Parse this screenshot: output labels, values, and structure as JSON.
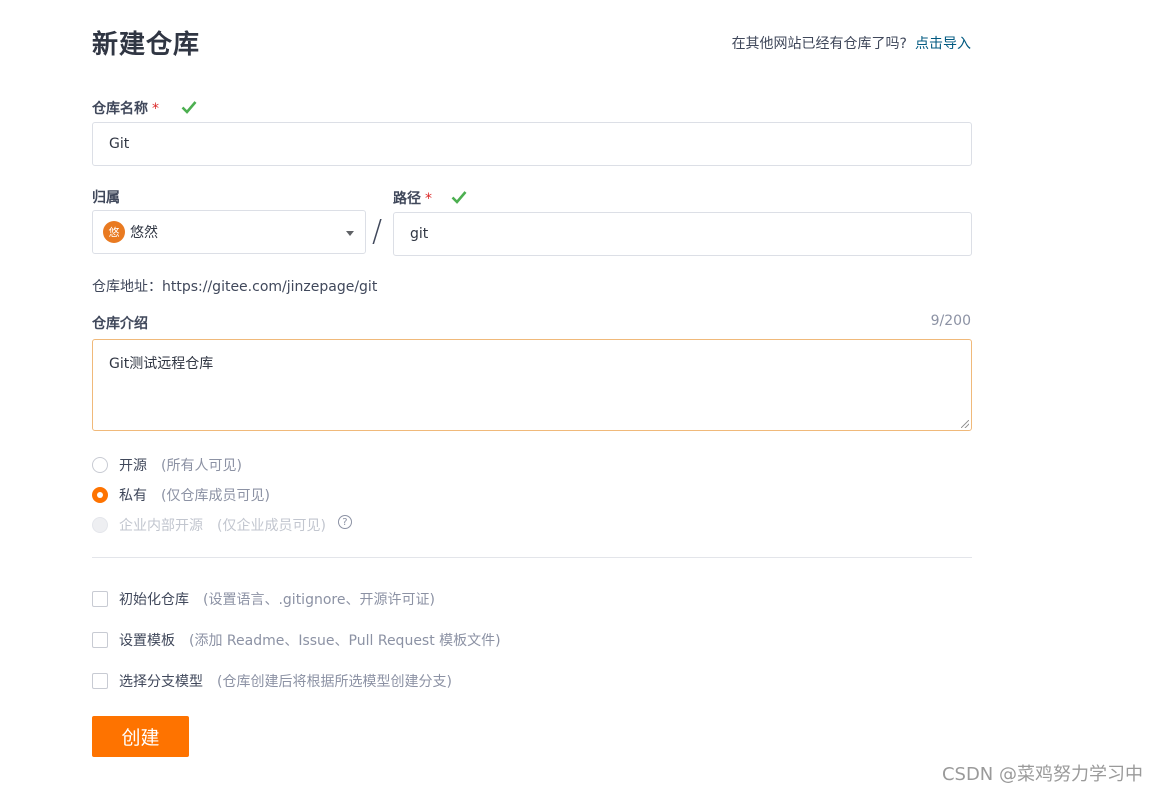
{
  "header": {
    "title": "新建仓库",
    "import_hint": "在其他网站已经有仓库了吗?",
    "import_link": "点击导入"
  },
  "repo_name": {
    "label": "仓库名称",
    "required_mark": "*",
    "value": "Git"
  },
  "owner": {
    "label": "归属",
    "avatar_text": "悠",
    "value": "悠然"
  },
  "separator": "/",
  "path": {
    "label": "路径",
    "required_mark": "*",
    "value": "git"
  },
  "repo_address": "仓库地址：https://gitee.com/jinzepage/git",
  "description": {
    "label": "仓库介绍",
    "counter": "9/200",
    "value": "Git测试远程仓库"
  },
  "visibility": {
    "options": [
      {
        "label": "开源",
        "hint": "(所有人可见)",
        "checked": false,
        "disabled": false
      },
      {
        "label": "私有",
        "hint": "(仅仓库成员可见)",
        "checked": true,
        "disabled": false
      },
      {
        "label": "企业内部开源",
        "hint": "(仅企业成员可见)",
        "checked": false,
        "disabled": true
      }
    ],
    "help_icon": "?"
  },
  "options": [
    {
      "label": "初始化仓库",
      "hint": "(设置语言、.gitignore、开源许可证)"
    },
    {
      "label": "设置模板",
      "hint": "(添加 Readme、Issue、Pull Request 模板文件)"
    },
    {
      "label": "选择分支模型",
      "hint": "(仓库创建后将根据所选模型创建分支)"
    }
  ],
  "submit_label": "创建",
  "watermark": "CSDN @菜鸡努力学习中",
  "colors": {
    "accent": "#fe7300",
    "link": "#005980",
    "valid": "#4caf50",
    "required": "#db2828"
  }
}
